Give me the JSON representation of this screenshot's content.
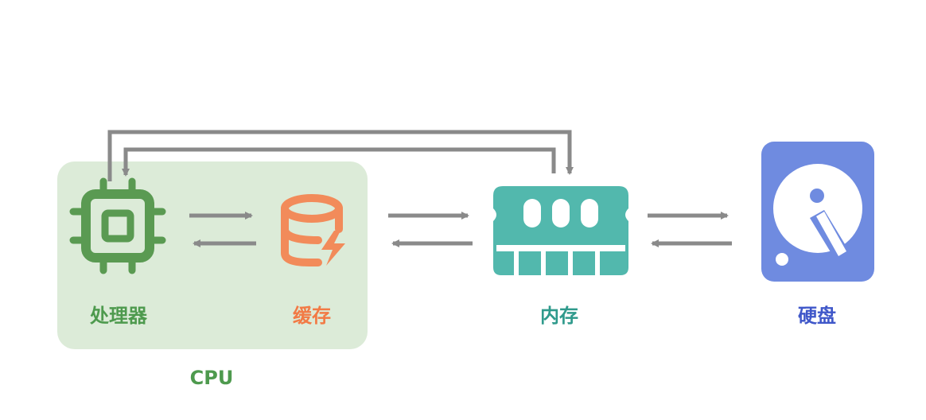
{
  "nodes": {
    "processor": {
      "label": "处理器",
      "color": "#4e9a4e",
      "icon": "cpu-chip-icon"
    },
    "cache": {
      "label": "缓存",
      "color": "#f27a45",
      "icon": "database-bolt-icon"
    },
    "memory": {
      "label": "内存",
      "color": "#2f9a8c",
      "icon": "ram-module-icon"
    },
    "disk": {
      "label": "硬盘",
      "color": "#3f57c9",
      "icon": "hard-disk-icon"
    }
  },
  "cpu_group": {
    "label": "CPU",
    "color": "#4e9a4e",
    "fill": "#dcebd8"
  },
  "colors": {
    "arrow": "#8a8a8a",
    "processor_icon": "#5a9a52",
    "cache_icon": "#f28b5a",
    "memory_icon": "#52b8ad",
    "disk_icon": "#6f8be0"
  }
}
